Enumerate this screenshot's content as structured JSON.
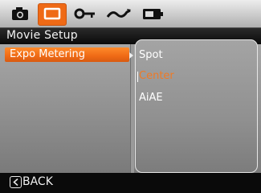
{
  "tabs": [
    {
      "icon": "camera-icon",
      "active": false
    },
    {
      "icon": "movie-icon",
      "active": true
    },
    {
      "icon": "wrench-icon",
      "active": false
    },
    {
      "icon": "wave-icon",
      "active": false
    },
    {
      "icon": "battery-icon",
      "active": false
    }
  ],
  "title": "Movie Setup",
  "menu": {
    "selected_label": "Expo Metering"
  },
  "options": {
    "items": [
      "Spot",
      "Center",
      "AiAE"
    ],
    "selected": "Center"
  },
  "footer": {
    "back_label": "BACK",
    "back_icon": "chevron-left-icon"
  },
  "colors": {
    "accent": "#ef6a16",
    "highlight_text": "#ef7a25"
  }
}
